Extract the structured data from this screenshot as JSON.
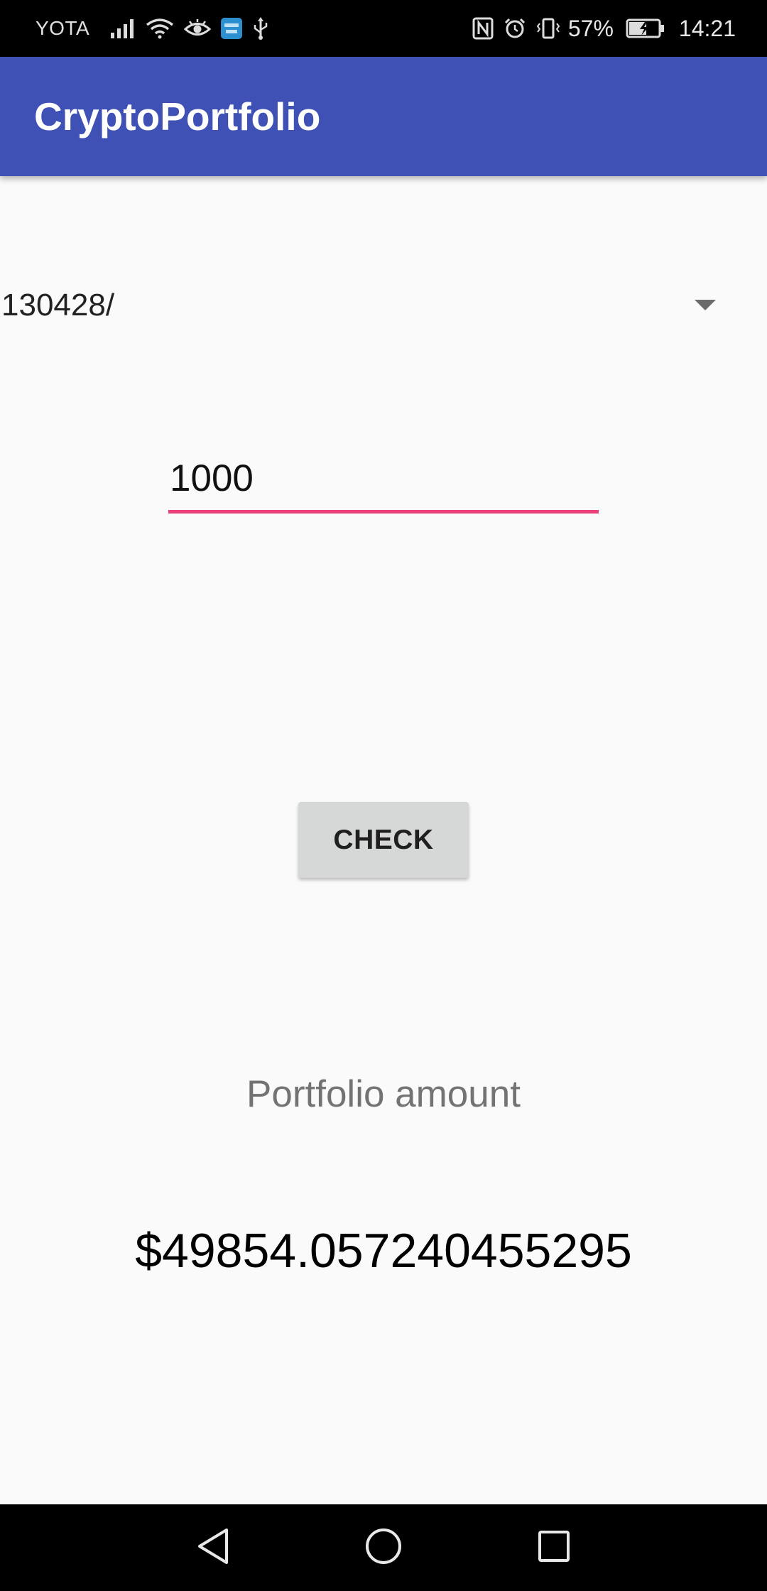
{
  "status_bar": {
    "carrier": "YOTA",
    "battery_percent": "57%",
    "time": "14:21",
    "icons": [
      "signal-icon",
      "wifi-icon",
      "eye-icon",
      "wordbit-app-icon",
      "usb-icon",
      "nfc-icon",
      "alarm-icon",
      "vibrate-icon",
      "battery-charging-icon"
    ]
  },
  "app_bar": {
    "title": "CryptoPortfolio",
    "color": "#3f51b5"
  },
  "spinner": {
    "selected_value": "130428/"
  },
  "amount_input": {
    "value": "1000",
    "underline_color": "#ec407a"
  },
  "check_button": {
    "label": "CHECK"
  },
  "portfolio": {
    "label": "Portfolio amount",
    "value": "$49854.057240455295"
  },
  "nav_bar": {
    "buttons": [
      "back-icon",
      "home-icon",
      "recents-icon"
    ]
  }
}
